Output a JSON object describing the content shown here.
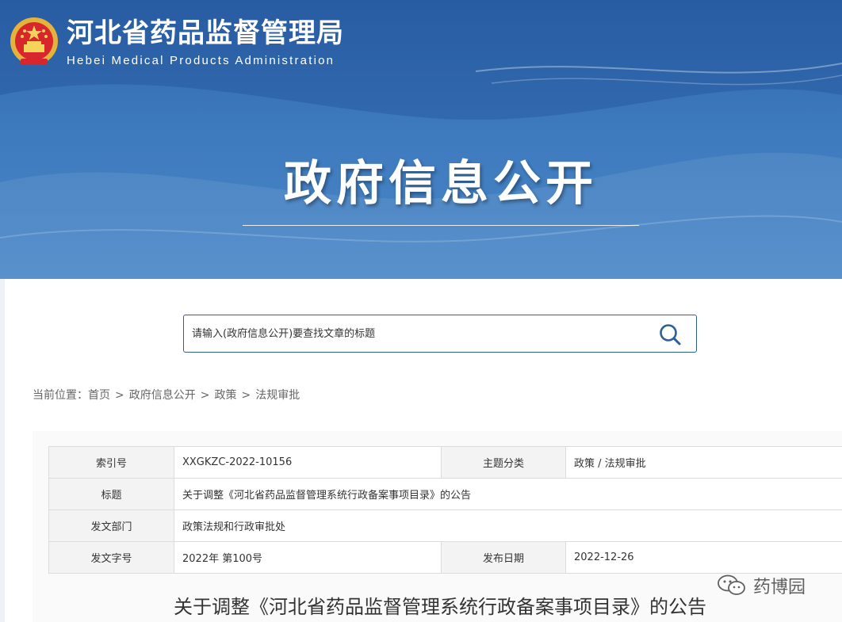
{
  "header": {
    "site_title": "河北省药品监督管理局",
    "site_subtitle": "Hebei Medical Products Administration",
    "section_title": "政府信息公开"
  },
  "search": {
    "placeholder": "请输入(政府信息公开)要查找文章的标题"
  },
  "breadcrumb": {
    "prefix": "当前位置：",
    "items": [
      "首页",
      "政府信息公开",
      "政策",
      "法规审批"
    ],
    "separator": ">"
  },
  "meta": {
    "index_label": "索引号",
    "index_value": "XXGKZC-2022-10156",
    "category_label": "主题分类",
    "category_value": "政策 / 法规审批",
    "title_label": "标题",
    "title_value": "关于调整《河北省药品监督管理系统行政备案事项目录》的公告",
    "dept_label": "发文部门",
    "dept_value": "政策法规和行政审批处",
    "docno_label": "发文字号",
    "docno_value": "2022年 第100号",
    "date_label": "发布日期",
    "date_value": "2022-12-26"
  },
  "document": {
    "title": "关于调整《河北省药品监督管理系统行政备案事项目录》的公告"
  },
  "watermark": {
    "text": "药博园"
  },
  "colors": {
    "banner": "#3a74b9",
    "search_border": "#2f5f98",
    "label_bg": "#f3f3f3",
    "border": "#dcdcdc"
  },
  "icons": {
    "emblem": "national-emblem-icon",
    "search": "search-icon",
    "watermark": "wechat-icon"
  }
}
